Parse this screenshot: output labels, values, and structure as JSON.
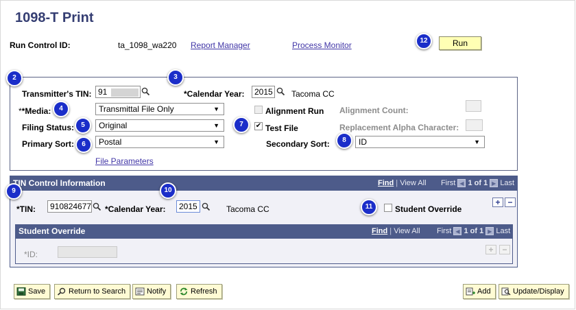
{
  "page": {
    "title": "1098-T Print",
    "run_control_label": "Run Control ID:",
    "run_control_value": "ta_1098_wa220",
    "report_manager": "Report Manager",
    "process_monitor": "Process Monitor",
    "run_button": "Run"
  },
  "callouts": [
    "2",
    "3",
    "4",
    "5",
    "6",
    "7",
    "8",
    "9",
    "10",
    "11",
    "12"
  ],
  "criteria": {
    "transmitter_tin_label": "Transmitter's TIN:",
    "transmitter_tin_value": "91",
    "calendar_year_label": "*Calendar Year:",
    "calendar_year_value": "2015",
    "institution": "Tacoma CC",
    "media_label": "*Media:",
    "media_value": "Transmittal File Only",
    "filing_status_label": "Filing Status:",
    "filing_status_value": "Original",
    "primary_sort_label": "Primary Sort:",
    "primary_sort_value": "Postal",
    "file_parameters": "File Parameters",
    "alignment_run_label": "Alignment Run",
    "alignment_run_checked": false,
    "test_file_label": "Test File",
    "test_file_checked": true,
    "alignment_count_label": "Alignment Count:",
    "replacement_alpha_label": "Replacement Alpha Character:",
    "secondary_sort_label": "Secondary Sort:",
    "secondary_sort_value": "ID"
  },
  "tin_control": {
    "header": "TIN Control Information",
    "find": "Find",
    "view_all": "View All",
    "first": "First",
    "range": "1 of 1",
    "last": "Last",
    "tin_label": "*TIN:",
    "tin_value": "910824677",
    "calendar_year_label": "*Calendar Year:",
    "calendar_year_value": "2015",
    "institution": "Tacoma CC",
    "student_override_label": "Student Override",
    "student_override_checked": false
  },
  "student_override": {
    "header": "Student Override",
    "find": "Find",
    "view_all": "View All",
    "first": "First",
    "range": "1 of 1",
    "last": "Last",
    "id_label": "*ID:",
    "id_value": ""
  },
  "toolbar": {
    "save": "Save",
    "return_to_search": "Return to Search",
    "notify": "Notify",
    "refresh": "Refresh",
    "add": "Add",
    "update_display": "Update/Display"
  },
  "colors": {
    "accent": "#4d5b8a",
    "callout": "#1b2ec9",
    "button_bg": "#fffbd4",
    "run_bg": "#ffffb4"
  }
}
